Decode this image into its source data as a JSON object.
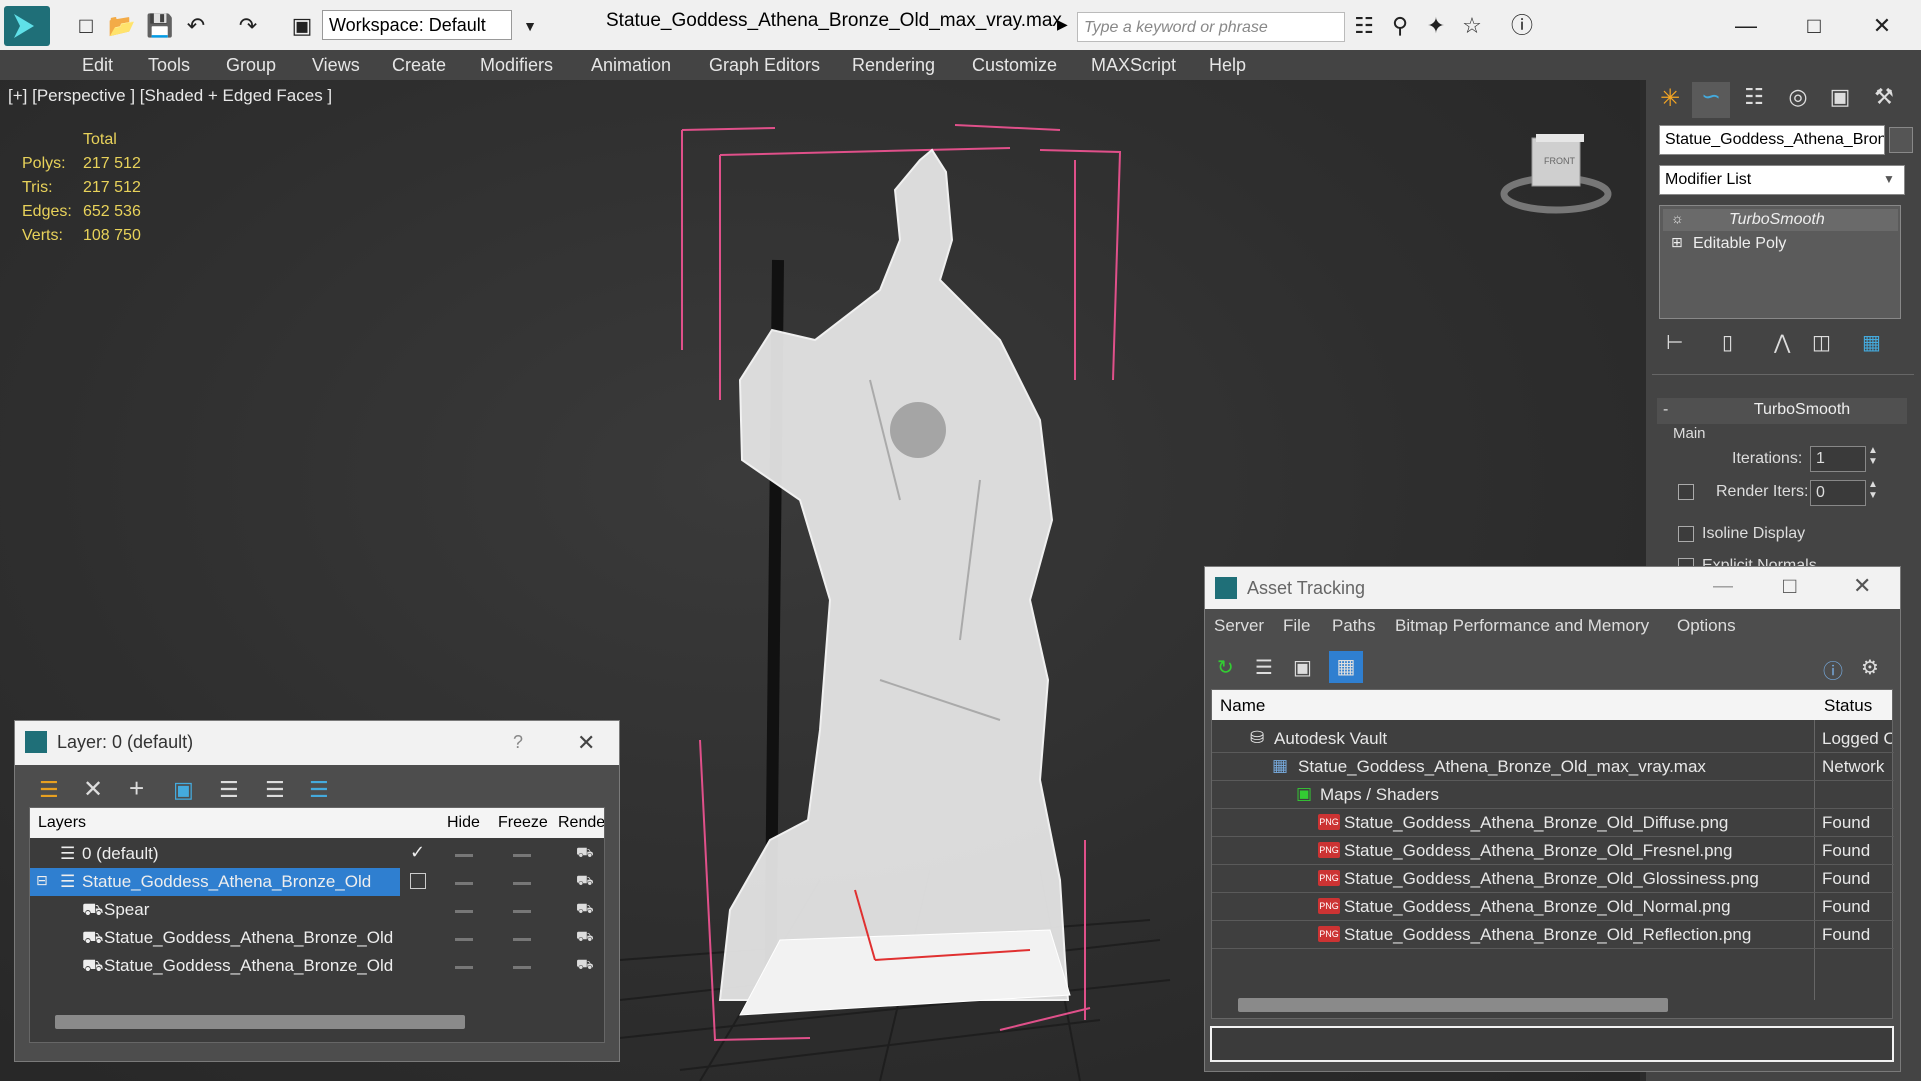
{
  "titlebar": {
    "workspace_label": "Workspace: Default",
    "file_title": "Statue_Goddess_Athena_Bronze_Old_max_vray.max",
    "search_placeholder": "Type a keyword or phrase"
  },
  "menu": [
    "Edit",
    "Tools",
    "Group",
    "Views",
    "Create",
    "Modifiers",
    "Animation",
    "Graph Editors",
    "Rendering",
    "Customize",
    "MAXScript",
    "Help"
  ],
  "viewport": {
    "label": "[+] [Perspective ] [Shaded + Edged Faces ]",
    "stats": {
      "header": "Total",
      "polys_label": "Polys:",
      "polys": "217 512",
      "tris_label": "Tris:",
      "tris": "217 512",
      "edges_label": "Edges:",
      "edges": "652 536",
      "verts_label": "Verts:",
      "verts": "108 750"
    },
    "viewcube_label": "FRONT"
  },
  "command_panel": {
    "object_name": "Statue_Goddess_Athena_Bronze",
    "modifier_list": "Modifier List",
    "stack": [
      "TurboSmooth",
      "Editable Poly"
    ],
    "rollout_title": "TurboSmooth",
    "group_main": "Main",
    "iterations_label": "Iterations:",
    "iterations": "1",
    "render_iters_label": "Render Iters:",
    "render_iters": "0",
    "isoline_label": "Isoline Display",
    "explicit_label": "Explicit Normals"
  },
  "layer_dialog": {
    "title": "Layer: 0 (default)",
    "help": "?",
    "columns": [
      "Layers",
      "Hide",
      "Freeze",
      "Rende"
    ],
    "rows": [
      {
        "name": "0 (default)"
      },
      {
        "name": "Statue_Goddess_Athena_Bronze_Old"
      },
      {
        "name": "Spear"
      },
      {
        "name": "Statue_Goddess_Athena_Bronze_Old"
      },
      {
        "name": "Statue_Goddess_Athena_Bronze_Old"
      }
    ]
  },
  "asset_dialog": {
    "title": "Asset Tracking",
    "menu": [
      "Server",
      "File",
      "Paths",
      "Bitmap Performance and Memory",
      "Options"
    ],
    "columns": [
      "Name",
      "Status"
    ],
    "rows": [
      {
        "name": "Autodesk Vault",
        "status": "Logged O"
      },
      {
        "name": "Statue_Goddess_Athena_Bronze_Old_max_vray.max",
        "status": "Network"
      },
      {
        "name": "Maps / Shaders",
        "status": ""
      },
      {
        "name": "Statue_Goddess_Athena_Bronze_Old_Diffuse.png",
        "status": "Found"
      },
      {
        "name": "Statue_Goddess_Athena_Bronze_Old_Fresnel.png",
        "status": "Found"
      },
      {
        "name": "Statue_Goddess_Athena_Bronze_Old_Glossiness.png",
        "status": "Found"
      },
      {
        "name": "Statue_Goddess_Athena_Bronze_Old_Normal.png",
        "status": "Found"
      },
      {
        "name": "Statue_Goddess_Athena_Bronze_Old_Reflection.png",
        "status": "Found"
      }
    ],
    "png_badge": "PNG"
  },
  "colors": {
    "accent": "#00a0b8",
    "selection": "#2f7fd0",
    "stats": "#e8d25a",
    "bbox": "#e0508a"
  },
  "icons": [
    "app-logo-icon",
    "new-file-icon",
    "open-file-icon",
    "save-icon",
    "undo-icon",
    "redo-icon",
    "binoculars-icon",
    "search-icon",
    "favorite-star-icon",
    "help-icon"
  ]
}
